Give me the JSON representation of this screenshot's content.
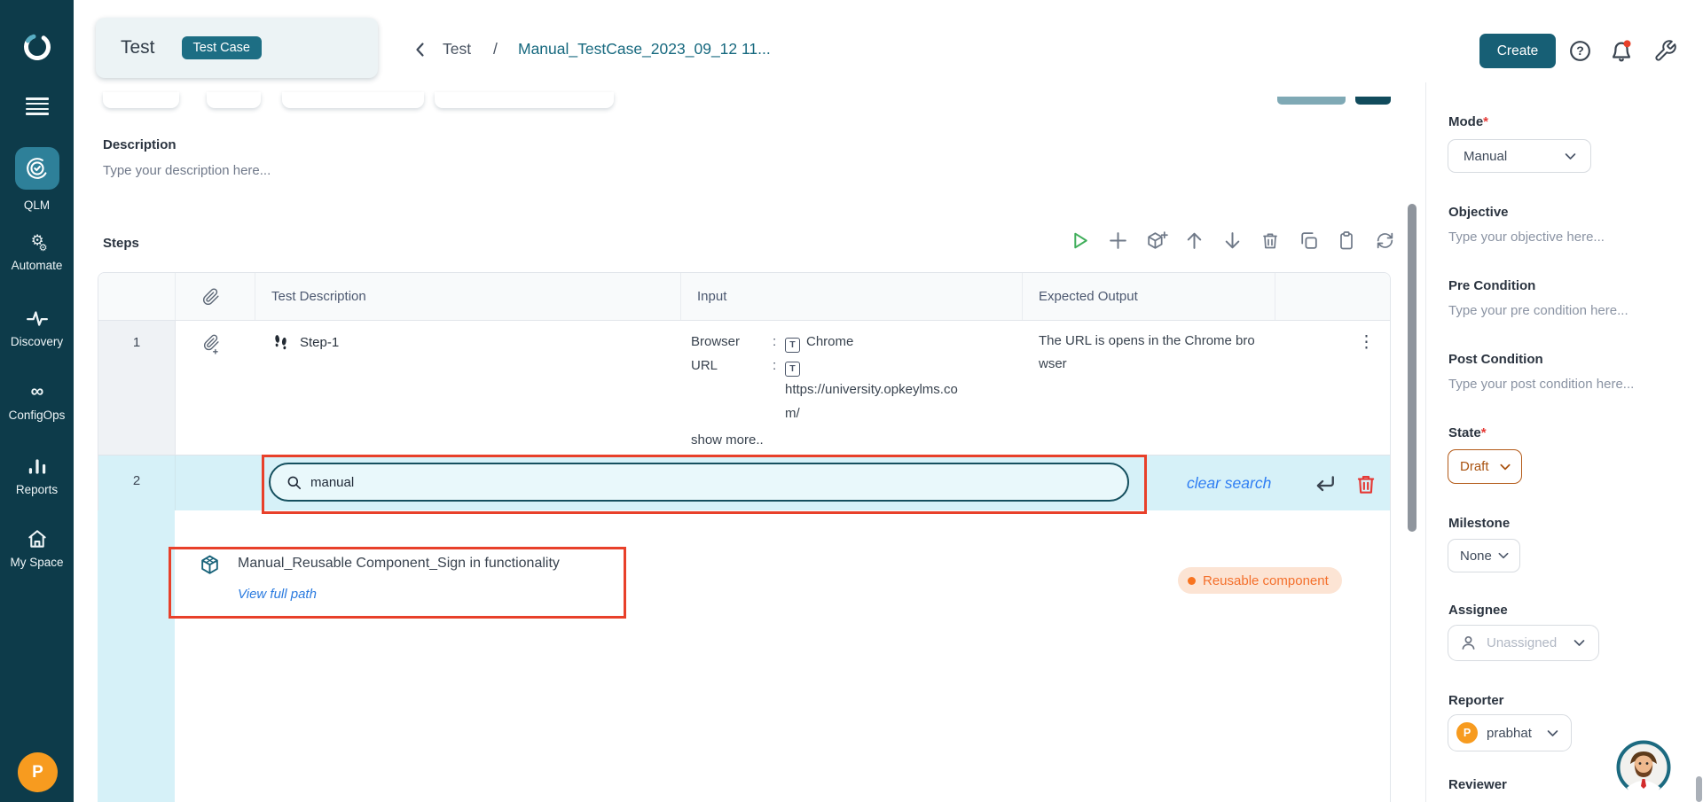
{
  "colors": {
    "sidebar_bg": "#0d3b4a",
    "brand_teal": "#175f75",
    "active_tile": "#2e8099",
    "highlight_red": "#e8402a",
    "row_highlight_cyan": "#d6f1f8",
    "badge_orange_text": "#f4702c",
    "badge_orange_bg": "#fce4d4",
    "state_orange": "#a9520f",
    "avatar_orange": "#f79b1f",
    "link_blue": "#2f7ef3"
  },
  "sidebar": {
    "items": [
      {
        "label": "QLM",
        "active": true
      },
      {
        "label": "Automate"
      },
      {
        "label": "Discovery"
      },
      {
        "label": "ConfigOps"
      },
      {
        "label": "Reports"
      },
      {
        "label": "My Space"
      }
    ],
    "user_initial": "P"
  },
  "header": {
    "entity": {
      "title": "Test",
      "badge": "Test Case"
    },
    "breadcrumb": {
      "parent": "Test",
      "separator": "/",
      "current": "Manual_TestCase_2023_09_12 11..."
    },
    "create_button": "Create"
  },
  "content": {
    "description": {
      "label": "Description",
      "placeholder": "Type your description here..."
    },
    "steps": {
      "title": "Steps",
      "table": {
        "headers": {
          "description": "Test Description",
          "input": "Input",
          "expected": "Expected Output"
        },
        "row1": {
          "number": "1",
          "name": "Step-1",
          "input_fields": [
            {
              "label": "Browser",
              "separator": ":",
              "icon": "T",
              "value": "Chrome"
            },
            {
              "label": "URL",
              "separator": ":",
              "icon": "T",
              "value": "https://university.opkeylms.com/"
            }
          ],
          "show_more": "show more..",
          "expected_output": "The URL is opens in the Chrome browser"
        },
        "row2": {
          "number": "2",
          "search_value": "manual",
          "clear_search": "clear search"
        }
      },
      "search_result": {
        "title": "Manual_Reusable Component_Sign in functionality",
        "link": "View full path",
        "badge": "Reusable component"
      }
    }
  },
  "details": {
    "mode": {
      "label": "Mode",
      "required": "*",
      "value": "Manual"
    },
    "objective": {
      "label": "Objective",
      "placeholder": "Type your objective here..."
    },
    "pre_condition": {
      "label": "Pre Condition",
      "placeholder": "Type your pre condition here..."
    },
    "post_condition": {
      "label": "Post Condition",
      "placeholder": "Type your post condition here..."
    },
    "state": {
      "label": "State",
      "required": "*",
      "value": "Draft"
    },
    "milestone": {
      "label": "Milestone",
      "value": "None"
    },
    "assignee": {
      "label": "Assignee",
      "value": "Unassigned"
    },
    "reporter": {
      "label": "Reporter",
      "value": "prabhat",
      "avatar_initial": "P"
    },
    "reviewer": {
      "label": "Reviewer"
    }
  }
}
